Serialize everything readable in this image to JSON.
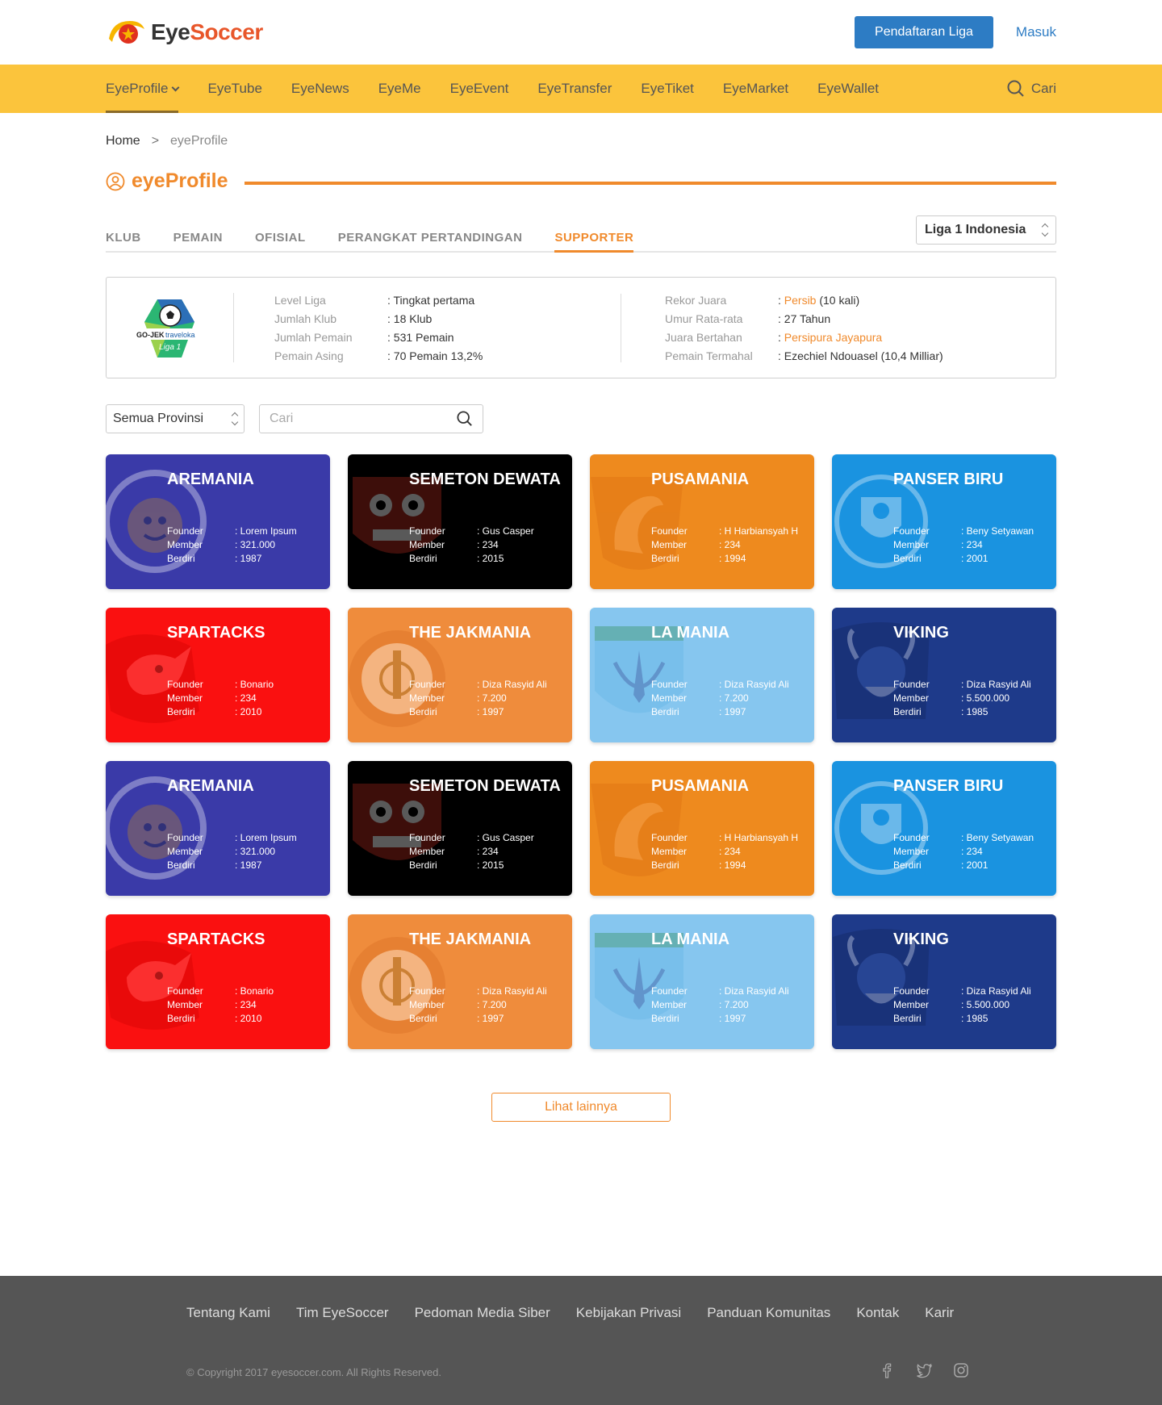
{
  "header": {
    "brand_eye": "Eye",
    "brand_soccer": "Soccer",
    "register_label": "Pendaftaran Liga",
    "login_label": "Masuk"
  },
  "nav": {
    "items": [
      "EyeProfile",
      "EyeTube",
      "EyeNews",
      "EyeMe",
      "EyeEvent",
      "EyeTransfer",
      "EyeTiket",
      "EyeMarket",
      "EyeWallet"
    ],
    "search_label": "Cari"
  },
  "breadcrumb": {
    "home": "Home",
    "sep": ">",
    "current": "eyeProfile"
  },
  "section": {
    "title": "eyeProfile"
  },
  "tabs": [
    "KLUB",
    "PEMAIN",
    "OFISIAL",
    "PERANGKAT PERTANDINGAN",
    "SUPPORTER"
  ],
  "league_select": "Liga 1 Indonesia",
  "league_info": {
    "logo_gojek": "GO-JEK",
    "logo_traveloka": "traveloka",
    "logo_liga": "Liga 1",
    "left": [
      {
        "k": "Level Liga",
        "v": ": Tingkat pertama"
      },
      {
        "k": "Jumlah Klub",
        "v": ": 18 Klub"
      },
      {
        "k": "Jumlah Pemain",
        "v": ": 531 Pemain"
      },
      {
        "k": "Pemain Asing",
        "v": ": 70 Pemain  13,2%"
      }
    ],
    "right": [
      {
        "k": "Rekor Juara",
        "pre": ": ",
        "hl": "Persib",
        "post": " (10 kali)"
      },
      {
        "k": "Umur Rata-rata",
        "pre": ": 27 Tahun",
        "hl": "",
        "post": ""
      },
      {
        "k": "Juara Bertahan",
        "pre": ": ",
        "hl": "Persipura Jayapura",
        "post": ""
      },
      {
        "k": "Pemain Termahal",
        "pre": ": Ezechiel Ndouasel  (10,4 Milliar)",
        "hl": "",
        "post": ""
      }
    ]
  },
  "filters": {
    "province": "Semua Provinsi",
    "search_placeholder": "Cari"
  },
  "labels": {
    "founder": "Founder",
    "member": "Member",
    "berdiri": "Berdiri"
  },
  "supporters": [
    {
      "name": "AREMANIA",
      "founder": ": Lorem Ipsum",
      "member": ": 321.000",
      "berdiri": ": 1987",
      "color": "#3a3aa8",
      "emblem": "lion"
    },
    {
      "name": "SEMETON DEWATA",
      "founder": ": Gus Casper",
      "member": ": 234",
      "berdiri": ": 2015",
      "color": "#000000",
      "emblem": "mask"
    },
    {
      "name": "PUSAMANIA",
      "founder": ": H Harbiansyah H",
      "member": ": 234",
      "berdiri": ": 1994",
      "color": "#ee8a1e",
      "emblem": "dolphin"
    },
    {
      "name": "PANSER BIRU",
      "founder": ": Beny Setyawan",
      "member": ": 234",
      "berdiri": ": 2001",
      "color": "#1a93e0",
      "emblem": "shield"
    },
    {
      "name": "SPARTACKS",
      "founder": ": Bonario",
      "member": ": 234",
      "berdiri": ": 2010",
      "color": "#fa1010",
      "emblem": "rhino"
    },
    {
      "name": "THE JAKMANIA",
      "founder": ": Diza Rasyid Ali",
      "member": ": 7.200",
      "berdiri": ": 1997",
      "color": "#ef8c3c",
      "emblem": "jakarta"
    },
    {
      "name": "LA MANIA",
      "founder": ": Diza Rasyid Ali",
      "member": ": 7.200",
      "berdiri": ": 1997",
      "color": "#86c6ef",
      "emblem": "persela"
    },
    {
      "name": "VIKING",
      "founder": ": Diza Rasyid Ali",
      "member": ": 5.500.000",
      "berdiri": ": 1985",
      "color": "#1e3a8a",
      "emblem": "viking"
    },
    {
      "name": "AREMANIA",
      "founder": ": Lorem Ipsum",
      "member": ": 321.000",
      "berdiri": ": 1987",
      "color": "#3a3aa8",
      "emblem": "lion"
    },
    {
      "name": "SEMETON DEWATA",
      "founder": ": Gus Casper",
      "member": ": 234",
      "berdiri": ": 2015",
      "color": "#000000",
      "emblem": "mask"
    },
    {
      "name": "PUSAMANIA",
      "founder": ": H Harbiansyah H",
      "member": ": 234",
      "berdiri": ": 1994",
      "color": "#ee8a1e",
      "emblem": "dolphin"
    },
    {
      "name": "PANSER BIRU",
      "founder": ": Beny Setyawan",
      "member": ": 234",
      "berdiri": ": 2001",
      "color": "#1a93e0",
      "emblem": "shield"
    },
    {
      "name": "SPARTACKS",
      "founder": ": Bonario",
      "member": ": 234",
      "berdiri": ": 2010",
      "color": "#fa1010",
      "emblem": "rhino"
    },
    {
      "name": "THE JAKMANIA",
      "founder": ": Diza Rasyid Ali",
      "member": ": 7.200",
      "berdiri": ": 1997",
      "color": "#ef8c3c",
      "emblem": "jakarta"
    },
    {
      "name": "LA MANIA",
      "founder": ": Diza Rasyid Ali",
      "member": ": 7.200",
      "berdiri": ": 1997",
      "color": "#86c6ef",
      "emblem": "persela"
    },
    {
      "name": "VIKING",
      "founder": ": Diza Rasyid Ali",
      "member": ": 5.500.000",
      "berdiri": ": 1985",
      "color": "#1e3a8a",
      "emblem": "viking"
    }
  ],
  "more_label": "Lihat lainnya",
  "footer": {
    "links": [
      "Tentang Kami",
      "Tim EyeSoccer",
      "Pedoman Media Siber",
      "Kebijakan Privasi",
      "Panduan Komunitas",
      "Kontak",
      "Karir"
    ],
    "copyright": "© Copyright 2017 eyesoccer.com. All Rights Reserved.",
    "social": [
      "facebook-icon",
      "twitter-icon",
      "instagram-icon"
    ]
  }
}
